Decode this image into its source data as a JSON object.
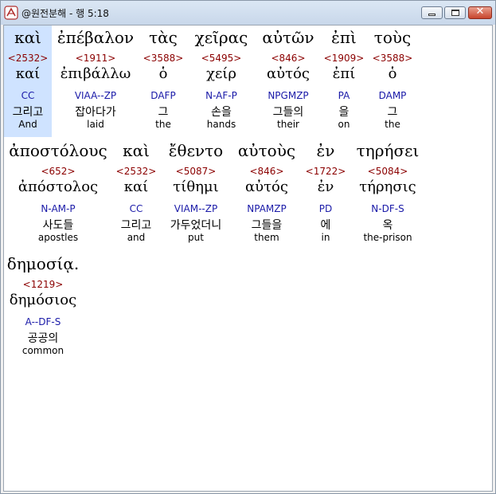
{
  "window": {
    "title": "@원전분해 - 행 5:18"
  },
  "verse": {
    "rows": [
      {
        "words": [
          {
            "greek": "καὶ",
            "strong": "<2532>",
            "lemma": "καί",
            "parse": "CC",
            "korean": "그리고",
            "english": "And"
          },
          {
            "greek": "ἐπέβαλον",
            "strong": "<1911>",
            "lemma": "ἐπιβάλλω",
            "parse": "VIAA--ZP",
            "korean": "잡아다가",
            "english": "laid"
          },
          {
            "greek": "τὰς",
            "strong": "<3588>",
            "lemma": "ὁ",
            "parse": "DAFP",
            "korean": "그",
            "english": "the"
          },
          {
            "greek": "χεῖρας",
            "strong": "<5495>",
            "lemma": "χείρ",
            "parse": "N-AF-P",
            "korean": "손을",
            "english": "hands"
          },
          {
            "greek": "αὐτῶν",
            "strong": "<846>",
            "lemma": "αὐτός",
            "parse": "NPGMZP",
            "korean": "그들의",
            "english": "their"
          },
          {
            "greek": "ἐπὶ",
            "strong": "<1909>",
            "lemma": "ἐπί",
            "parse": "PA",
            "korean": "을",
            "english": "on"
          },
          {
            "greek": "τοὺς",
            "strong": "<3588>",
            "lemma": "ὁ",
            "parse": "DAMP",
            "korean": "그",
            "english": "the"
          }
        ]
      },
      {
        "words": [
          {
            "greek": "ἀποστόλους",
            "strong": "<652>",
            "lemma": "ἀπόστολος",
            "parse": "N-AM-P",
            "korean": "사도들",
            "english": "apostles"
          },
          {
            "greek": "καὶ",
            "strong": "<2532>",
            "lemma": "καί",
            "parse": "CC",
            "korean": "그리고",
            "english": "and"
          },
          {
            "greek": "ἔθεντο",
            "strong": "<5087>",
            "lemma": "τίθημι",
            "parse": "VIAM--ZP",
            "korean": "가두었더니",
            "english": "put"
          },
          {
            "greek": "αὐτοὺς",
            "strong": "<846>",
            "lemma": "αὐτός",
            "parse": "NPAMZP",
            "korean": "그들을",
            "english": "them"
          },
          {
            "greek": "ἐν",
            "strong": "<1722>",
            "lemma": "ἐν",
            "parse": "PD",
            "korean": "에",
            "english": "in"
          },
          {
            "greek": "τηρήσει",
            "strong": "<5084>",
            "lemma": "τήρησις",
            "parse": "N-DF-S",
            "korean": "옥",
            "english": "the-prison"
          }
        ]
      },
      {
        "words": [
          {
            "greek": "δημοσίᾳ.",
            "strong": "<1219>",
            "lemma": "δημόσιος",
            "parse": "A--DF-S",
            "korean": "공공의",
            "english": "common"
          }
        ]
      }
    ]
  },
  "colors": {
    "strong_number": "#8b0000",
    "parse_code": "#1a1aa8",
    "selection_highlight": "#cfe3ff"
  }
}
